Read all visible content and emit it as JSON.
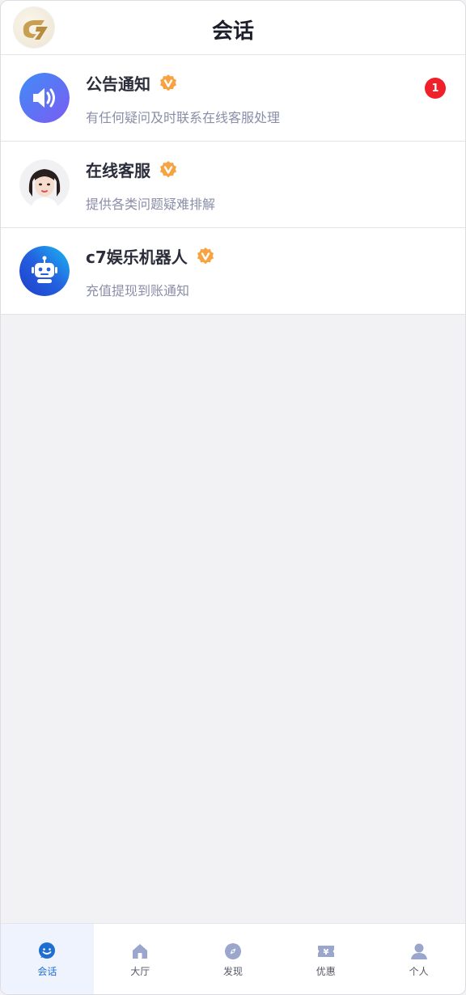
{
  "header": {
    "title": "会话"
  },
  "conversations": [
    {
      "name": "公告通知",
      "desc": "有任何疑问及时联系在线客服处理",
      "unread": "1",
      "avatar_icon": "speaker-icon"
    },
    {
      "name": "在线客服",
      "desc": "提供各类问题疑难排解",
      "avatar_icon": "customer-service-avatar"
    },
    {
      "name": "c7娱乐机器人",
      "desc": "充值提现到账通知",
      "avatar_icon": "robot-icon"
    }
  ],
  "tabbar": {
    "items": [
      {
        "label": "会话",
        "icon": "chat-icon",
        "active": true
      },
      {
        "label": "大厅",
        "icon": "home-icon"
      },
      {
        "label": "发现",
        "icon": "compass-icon"
      },
      {
        "label": "优惠",
        "icon": "coupon-icon"
      },
      {
        "label": "个人",
        "icon": "user-icon"
      }
    ]
  },
  "colors": {
    "accent": "#1f6fd1",
    "verify_badge": "#f7a341",
    "unread_badge": "#f0202a"
  }
}
